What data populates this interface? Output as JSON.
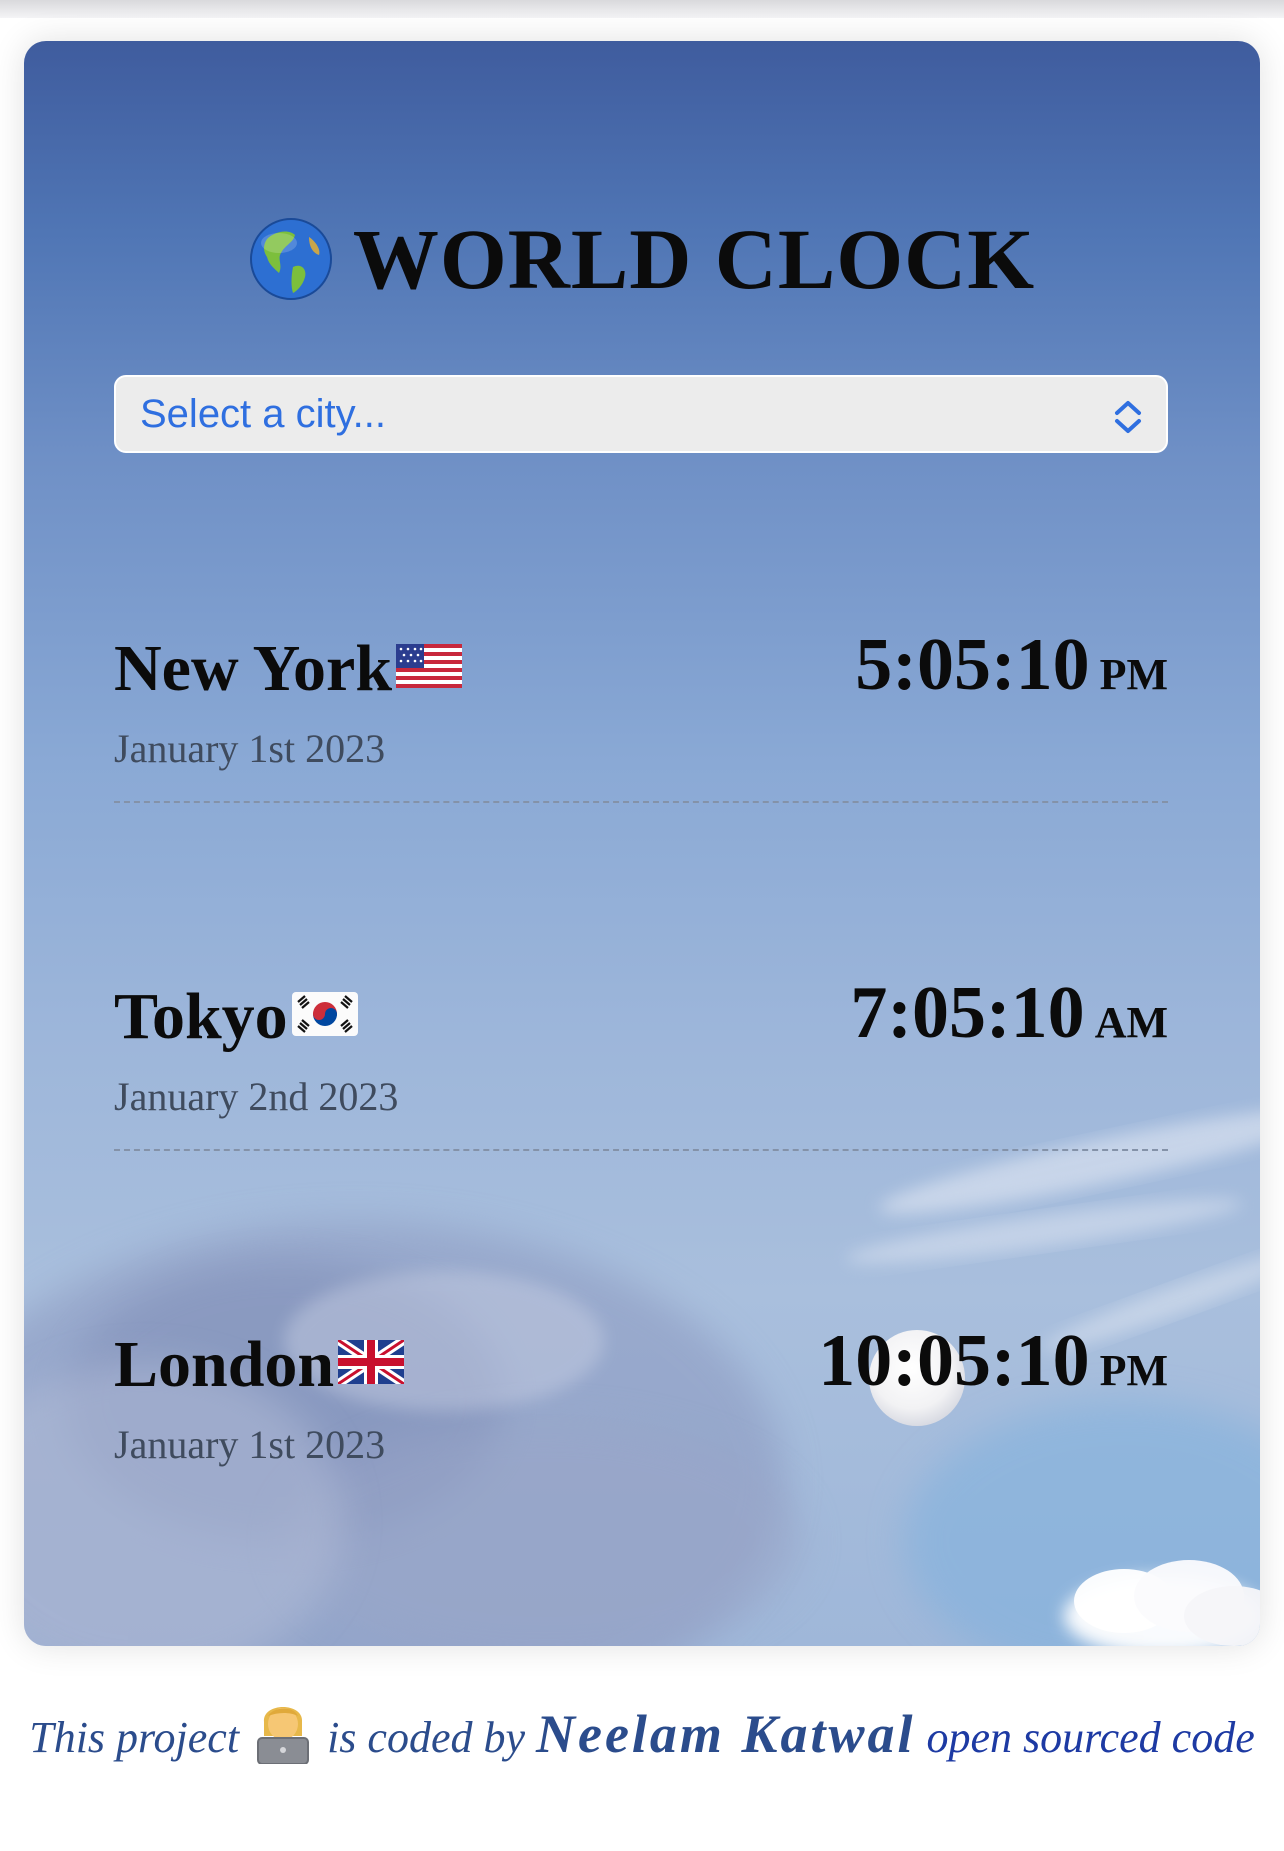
{
  "app": {
    "title": "WORLD CLOCK",
    "globe_icon": "globe-americas-icon"
  },
  "city_select": {
    "placeholder": "Select a city...",
    "chevron_icon": "up-down-chevron-icon"
  },
  "cities": [
    {
      "name": "New York",
      "flag": "us-flag-icon",
      "date": "January 1st 2023",
      "time": "5:05:10",
      "ampm": "PM"
    },
    {
      "name": "Tokyo",
      "flag": "kr-flag-icon",
      "date": "January 2nd 2023",
      "time": "7:05:10",
      "ampm": "AM"
    },
    {
      "name": "London",
      "flag": "uk-flag-icon",
      "date": "January 1st 2023",
      "time": "10:05:10",
      "ampm": "PM"
    }
  ],
  "footer": {
    "prefix": "This project",
    "coder_icon": "woman-technologist-icon",
    "middle": " is coded by ",
    "author": "Neelam Katwal",
    "link": " open sourced code"
  },
  "colors": {
    "select_text": "#2f6fe0",
    "footer_text": "#2b4c8c",
    "title_text": "#0b0b0b"
  }
}
